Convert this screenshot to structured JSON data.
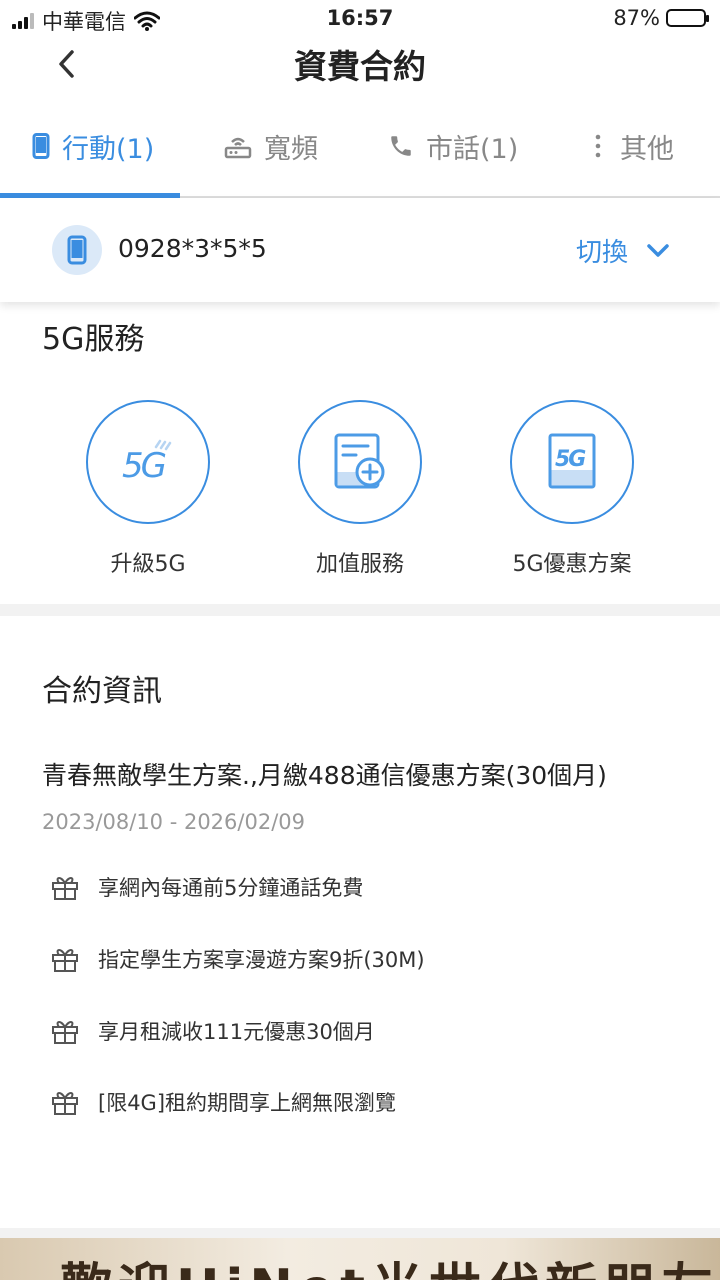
{
  "status_bar": {
    "carrier": "中華電信",
    "time": "16:57",
    "battery": "87%",
    "battery_level": 0.87
  },
  "header": {
    "title": "資費合約",
    "back_icon": "chevron-left-icon"
  },
  "tabs": [
    {
      "label": "行動(1)",
      "icon": "mobile-phone-icon",
      "active": true
    },
    {
      "label": "寬頻",
      "icon": "router-icon",
      "active": false
    },
    {
      "label": "市話(1)",
      "icon": "telephone-icon",
      "active": false
    },
    {
      "label": "其他",
      "icon": "more-vertical-icon",
      "active": false
    }
  ],
  "account": {
    "number": "0928*3*5*5",
    "switch_label": "切換"
  },
  "services": {
    "title": "5G服務",
    "items": [
      {
        "label": "升級5G",
        "icon": "5g-signal-icon"
      },
      {
        "label": "加值服務",
        "icon": "document-add-icon"
      },
      {
        "label": "5G優惠方案",
        "icon": "5g-card-icon"
      }
    ]
  },
  "contract": {
    "title": "合約資訊",
    "plan_name": "青春無敵學生方案.,月繳488通信優惠方案(30個月)",
    "dates": "2023/08/10 - 2026/02/09",
    "benefits": [
      "享網內每通前5分鐘通話免費",
      "指定學生方案享漫遊方案9折(30M)",
      "享月租減收111元優惠30個月",
      "[限4G]租約期間享上網無限瀏覽"
    ]
  },
  "banner": {
    "text": "歡迎HiNet光世代新朋友"
  },
  "colors": {
    "accent": "#3a8de0",
    "accent_light": "#dbe9f8",
    "background": "#f2f2f2"
  }
}
